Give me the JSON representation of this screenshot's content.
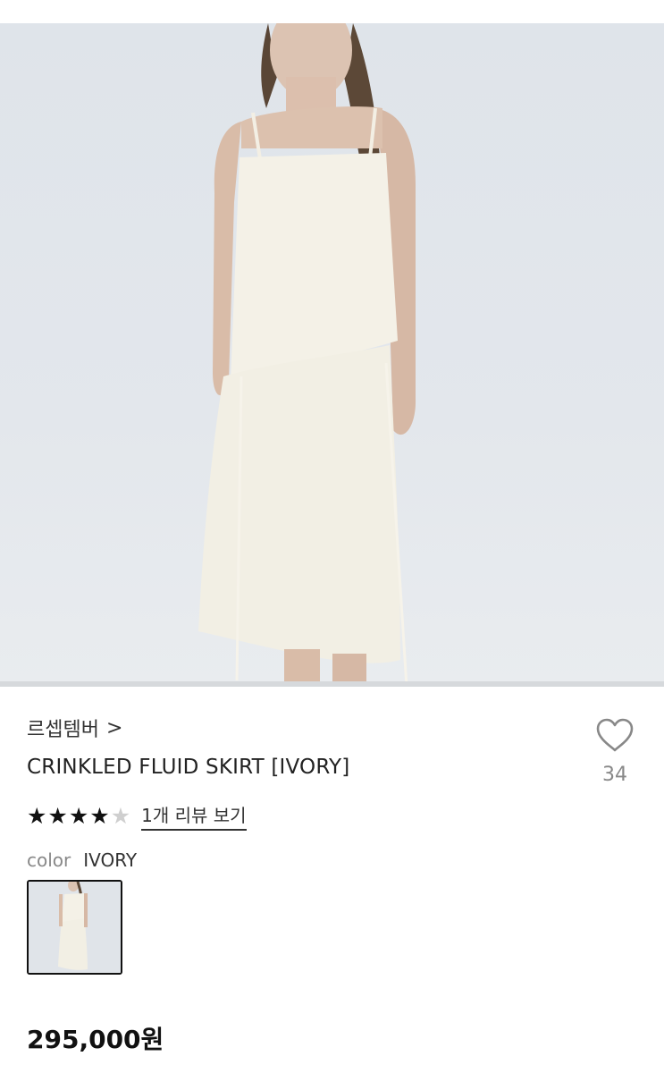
{
  "product": {
    "image_icon": "model-photo",
    "brand": "르셉템버",
    "brand_chevron": ">",
    "title": "CRINKLED FLUID SKIRT [IVORY]",
    "like_count": "34",
    "rating": {
      "stars_filled": 4,
      "stars_total": 5,
      "review_link": "1개 리뷰 보기"
    },
    "option": {
      "label": "color",
      "value": "IVORY"
    },
    "price": "295,000원"
  }
}
